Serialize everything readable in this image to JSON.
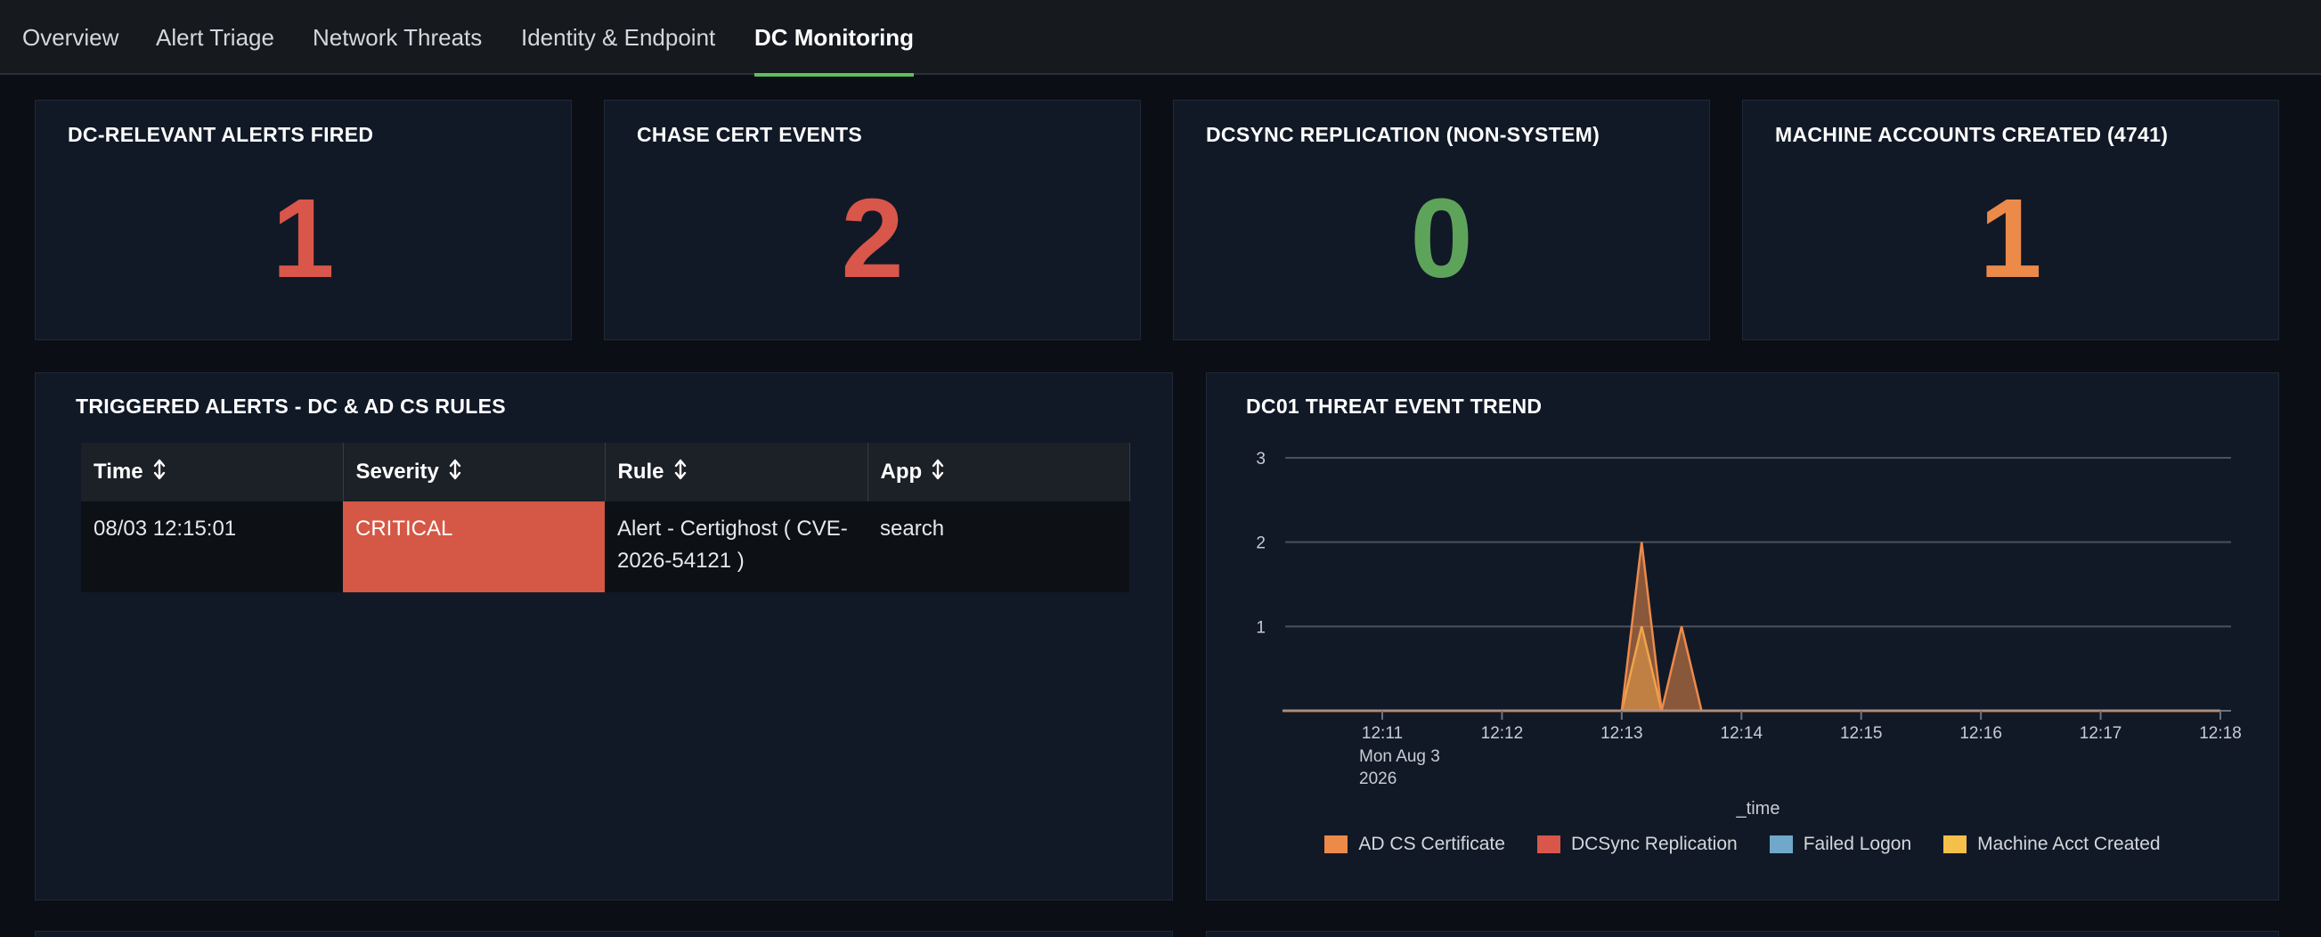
{
  "nav": {
    "tabs": [
      {
        "label": "Overview"
      },
      {
        "label": "Alert Triage"
      },
      {
        "label": "Network Threats"
      },
      {
        "label": "Identity & Endpoint"
      },
      {
        "label": "DC Monitoring",
        "active": true
      }
    ]
  },
  "kpis": [
    {
      "title": "DC-RELEVANT ALERTS FIRED",
      "value": "1",
      "color": "#d9564a"
    },
    {
      "title": "CHASE CERT EVENTS",
      "value": "2",
      "color": "#d9564a"
    },
    {
      "title": "DCSYNC REPLICATION (NON-SYSTEM)",
      "value": "0",
      "color": "#5ea35a"
    },
    {
      "title": "MACHINE ACCOUNTS CREATED (4741)",
      "value": "1",
      "color": "#ec8a4a"
    }
  ],
  "alerts_panel": {
    "title": "TRIGGERED ALERTS - DC & AD CS RULES",
    "columns": [
      "Time",
      "Severity",
      "Rule",
      "App"
    ],
    "rows": [
      {
        "time": "08/03 12:15:01",
        "severity": "CRITICAL",
        "rule": "Alert - Certighost ( CVE-2026-54121 )",
        "app": "search"
      }
    ],
    "severity_color": "#d45845"
  },
  "trend_panel": {
    "title": "DC01 THREAT EVENT TREND"
  },
  "chart_data": {
    "type": "area",
    "title": "DC01 THREAT EVENT TREND",
    "xlabel": "_time",
    "ylabel": "",
    "ylim": [
      0,
      3
    ],
    "yticks": [
      "1",
      "2",
      "3"
    ],
    "xticks": [
      "12:11",
      "12:12",
      "12:13",
      "12:14",
      "12:15",
      "12:16",
      "12:17",
      "12:18"
    ],
    "xtick_first_sub": [
      "Mon Aug 3",
      "2026"
    ],
    "x": [
      "12:10:10",
      "12:13:00",
      "12:13:10",
      "12:13:20",
      "12:13:30",
      "12:13:40",
      "12:13:50",
      "12:14:00",
      "12:18:00"
    ],
    "series": [
      {
        "name": "AD CS Certificate",
        "color": "#ec8a4a",
        "values": [
          0,
          0,
          2,
          0,
          1,
          0,
          0,
          0,
          0
        ]
      },
      {
        "name": "DCSync Replication",
        "color": "#d9564a",
        "values": [
          0,
          0,
          0,
          0,
          0,
          0,
          0,
          0,
          0
        ]
      },
      {
        "name": "Failed Logon",
        "color": "#6fa8c8",
        "values": [
          0,
          0,
          0,
          0,
          0,
          0,
          0,
          0,
          0
        ]
      },
      {
        "name": "Machine Acct Created",
        "color": "#f4c04a",
        "values": [
          0,
          0,
          1,
          0,
          0,
          0,
          0,
          0,
          0
        ]
      }
    ]
  }
}
